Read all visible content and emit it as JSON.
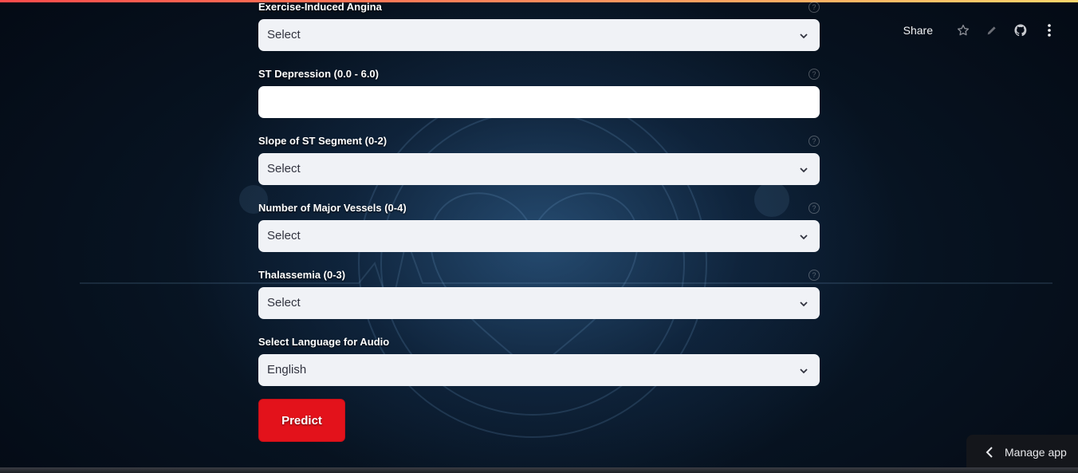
{
  "toolbar": {
    "share_label": "Share",
    "icons": [
      "star-icon",
      "pencil-icon",
      "github-icon",
      "more-vertical-icon"
    ]
  },
  "form": {
    "angina": {
      "label": "Exercise-Induced Angina",
      "value": "Select"
    },
    "st_depression": {
      "label": "ST Depression (0.0 - 6.0)",
      "value": ""
    },
    "slope": {
      "label": "Slope of ST Segment (0-2)",
      "value": "Select"
    },
    "vessels": {
      "label": "Number of Major Vessels (0-4)",
      "value": "Select"
    },
    "thalassemia": {
      "label": "Thalassemia (0-3)",
      "value": "Select"
    },
    "language": {
      "label": "Select Language for Audio",
      "value": "English"
    }
  },
  "predict_label": "Predict",
  "manage_app_label": "Manage app",
  "colors": {
    "accent": "#e3121b",
    "select_bg": "#f0f2f6",
    "background": "#071321"
  }
}
